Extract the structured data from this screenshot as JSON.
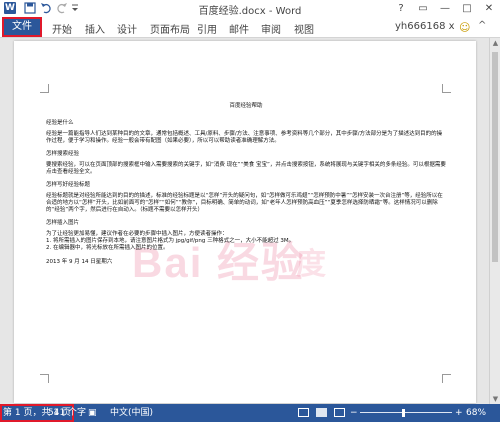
{
  "window": {
    "title": "百度经验.docx - Word",
    "controls": {
      "help": "?",
      "ribbon_options": "▭",
      "minimize": "—",
      "restore": "□",
      "close": "✕"
    }
  },
  "quick_access": {
    "app_icon": "W",
    "icons": [
      "save-icon",
      "undo-icon",
      "redo-icon",
      "customize-quick-access-icon"
    ]
  },
  "ribbon": {
    "file_tab": "文件",
    "tabs": [
      "开始",
      "插入",
      "设计",
      "页面布局",
      "引用",
      "邮件",
      "审阅",
      "视图"
    ],
    "user": "yh666168 x",
    "collapse": "^"
  },
  "document": {
    "heading": "百度经验帮助",
    "paragraphs": [
      "经验是什么",
      "经验是一篇能指导人们达到某种目的的文章，通常包括概述、工具/原料、步骤/方法、注意事项、参考资料等几个部分，其中步骤/方法部分是为了描述达到目的的操作过程，便于学习和操作。经验一般会带有配图（如果必要），所以可以帮助读者准确理解方法。",
      "怎样搜索经验",
      "要搜索经验，可以在页面顶部的搜索框中输入需要搜索的关键字，如“消费 现在”“美食 宝宝”，并点击搜索按钮，系统将展现与关键字相关的多条经验。可以根据需要点击查看经验全文。",
      "怎样写好经验标题",
      "经验标题就是对经验所能达到的目的的描述，标准的经验标题是以“怎样”开头的疑问句，如“怎样做可乐鸡翅”“怎样预防中暑”“怎样安装一次台注册”等，经验所以在合适的地方以“怎样”开头，比如前面写的“怎样”“如何”“教你”，目标明确、简单的动词，如“老年人怎样预防高血压”“夏季怎样选择防晒霜”等。这样情况可以删除的“经验”两个字，然后进行在自动入。（标题不需要以怎样开头）",
      "怎样插入图片",
      "为了让经验更加易懂，建议作者在必要的步骤中插入图片，方便读者操作：",
      "1. 将所需插入的图片保存到本地，请注意图片格式为 jpg/gif/png 三种格式之一，大小不能超过 3M。",
      "2. 在编辑器中，将光标放在所需插入图片的位置。",
      "2013 年 9 月 14 日星期六"
    ],
    "watermark": "Bai 经验",
    "watermark_sub": "度"
  },
  "statusbar": {
    "page": "第 1 页，共 1 页",
    "words": "541 个字",
    "proofing_icon": "▣",
    "language": "中文(中国)",
    "zoom_out": "−",
    "zoom_in": "+",
    "zoom": "68%",
    "zoom_fraction": 0.47
  },
  "colors": {
    "accent": "#2b579a",
    "highlight": "#e0192b"
  }
}
